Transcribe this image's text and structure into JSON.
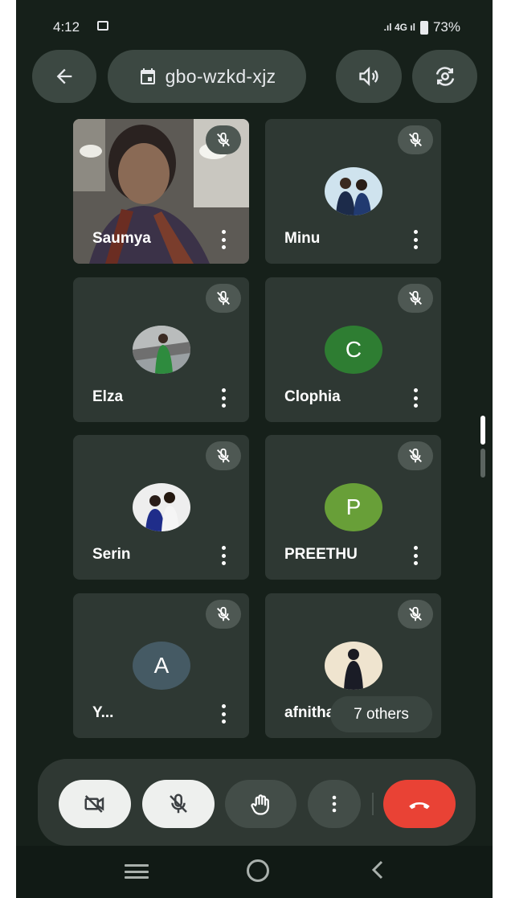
{
  "status": {
    "time": "4:12",
    "signal_text": ".ıl 4G ıl",
    "battery": "73%"
  },
  "header": {
    "meeting_code": "gbo-wzkd-xjz"
  },
  "participants": [
    {
      "name": "Saumya",
      "kind": "video"
    },
    {
      "name": "Minu",
      "kind": "photo"
    },
    {
      "name": "Elza",
      "kind": "photo"
    },
    {
      "name": "Clophia",
      "kind": "letter",
      "letter": "C",
      "color": "#2e7d32"
    },
    {
      "name": "Serin",
      "kind": "photo"
    },
    {
      "name": "PREETHU",
      "kind": "letter",
      "letter": "P",
      "color": "#689f38"
    },
    {
      "name": "Y...",
      "kind": "letter",
      "letter": "A",
      "color": "#455a64"
    },
    {
      "name": "afnitha",
      "kind": "photo"
    }
  ],
  "others_chip": "7 others",
  "colors": {
    "background": "#16201a",
    "tile": "#2e3833",
    "end_call": "#e94235"
  },
  "icons": [
    "back-arrow-icon",
    "calendar-icon",
    "speaker-icon",
    "camera-flip-icon",
    "mic-off-icon",
    "camera-off-icon",
    "raise-hand-icon",
    "more-vert-icon",
    "end-call-icon",
    "nav-menu-icon",
    "nav-home-icon",
    "nav-back-icon"
  ]
}
